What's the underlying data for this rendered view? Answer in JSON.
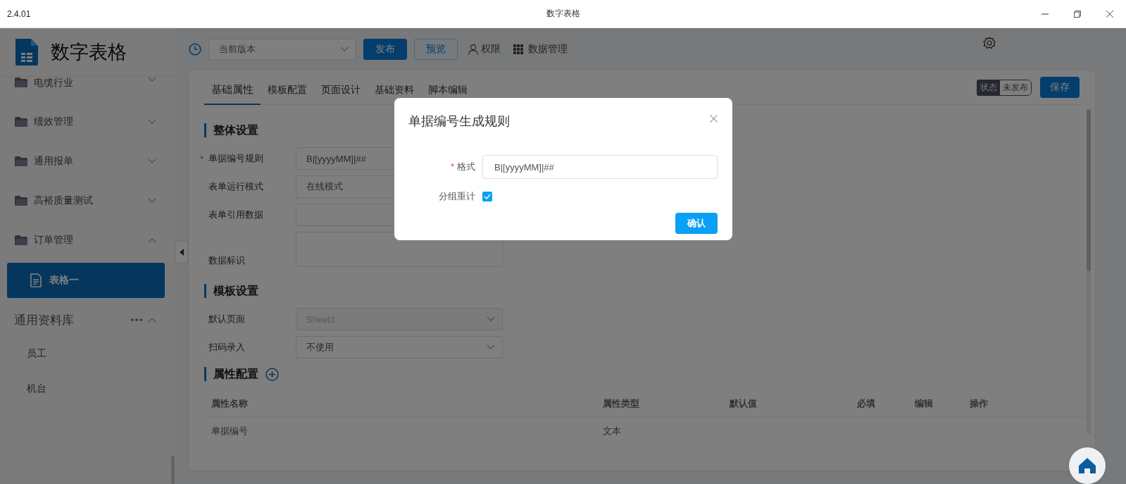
{
  "window": {
    "version": "2.4.01",
    "title": "数字表格"
  },
  "sidebar": {
    "app_name": "数字表格",
    "groups": [
      {
        "label": "电缆行业",
        "expanded": false
      },
      {
        "label": "绩效管理",
        "expanded": false
      },
      {
        "label": "通用报单",
        "expanded": false
      },
      {
        "label": "高裕质量测试",
        "expanded": false
      },
      {
        "label": "订单管理",
        "expanded": true,
        "children": [
          {
            "label": "表格一",
            "selected": true
          }
        ]
      }
    ],
    "library": {
      "label": "通用资料库",
      "expanded": true,
      "items": [
        {
          "label": "员工",
          "selected": false
        },
        {
          "label": "机台",
          "selected": false
        }
      ]
    }
  },
  "toolbar": {
    "version_select": {
      "value": "当前版本"
    },
    "publish": "发布",
    "preview": "预览",
    "permissions": "权限",
    "data_management": "数据管理"
  },
  "tabs": [
    {
      "label": "基础属性",
      "selected": true
    },
    {
      "label": "模板配置",
      "selected": false
    },
    {
      "label": "页面设计",
      "selected": false
    },
    {
      "label": "基础资料",
      "selected": false
    },
    {
      "label": "脚本编辑",
      "selected": false
    }
  ],
  "status": {
    "label": "状态",
    "value": "未发布"
  },
  "save": "保存",
  "sections": [
    {
      "title": "整体设置",
      "fields": [
        {
          "label": "单据编号规则",
          "required_mark": "*",
          "kind": "input",
          "value": "B|[yyyyMM]|##"
        },
        {
          "label": "表单运行模式",
          "kind": "input",
          "value": "在线模式"
        },
        {
          "label": "表单引用数据",
          "kind": "input"
        },
        {
          "label": "数据标识",
          "kind": "textarea"
        }
      ]
    },
    {
      "title": "模板设置",
      "fields": [
        {
          "label": "默认页面",
          "kind": "select",
          "value": "Sheet1",
          "disabled": true
        },
        {
          "label": "扫码录入",
          "kind": "select",
          "value": "不使用",
          "disabled": false
        }
      ]
    }
  ],
  "attributes": {
    "title": "属性配置",
    "columns": [
      "属性名称",
      "属性类型",
      "默认值",
      "必填",
      "编辑",
      "操作"
    ],
    "rows": [
      [
        "单据编号",
        "文本"
      ]
    ]
  },
  "dialog": {
    "title": "单据编号生成规则",
    "format": {
      "label": "格式",
      "required_mark": "*",
      "value": "B|[yyyyMM]|##"
    },
    "regroup": {
      "label": "分组重计",
      "checked": true
    },
    "confirm": "确认"
  }
}
